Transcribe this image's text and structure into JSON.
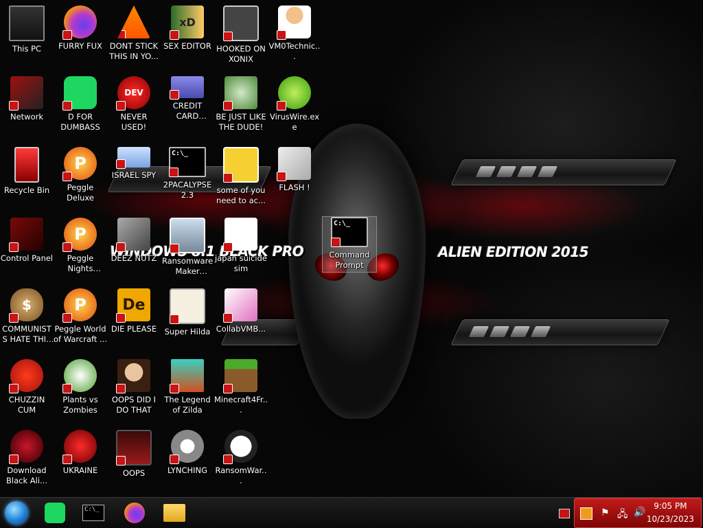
{
  "wallpaper": {
    "banner_left": "WINDOWS 8.1 BLACK PRO",
    "banner_right": "ALIEN EDITION 2015"
  },
  "desktop_icons": [
    {
      "label": "This PC",
      "icon": "computer-icon"
    },
    {
      "label": "FURRY FUX",
      "icon": "firefox-icon"
    },
    {
      "label": "DONT STICK THIS IN YO...",
      "icon": "vlc-cone-icon"
    },
    {
      "label": "SEX EDITOR",
      "icon": "hxd-icon"
    },
    {
      "label": "HOOKED ON XONIX",
      "icon": "xonix-icon"
    },
    {
      "label": "VM0Technic...",
      "icon": "person-icon"
    },
    {
      "label": "Network",
      "icon": "network-icon"
    },
    {
      "label": "D FOR DUMBASS",
      "icon": "spotify-icon"
    },
    {
      "label": "NEVER USED!",
      "icon": "devcpp-icon"
    },
    {
      "label": "CREDIT CARD CHECKER",
      "icon": "credit-card-icon"
    },
    {
      "label": "BE JUST LIKE THE DUDE!",
      "icon": "elf-icon"
    },
    {
      "label": "VirusWire.exe",
      "icon": "limewire-icon"
    },
    {
      "label": "Recycle Bin",
      "icon": "recycle-bin-icon"
    },
    {
      "label": "Peggle Deluxe",
      "icon": "peggle-icon"
    },
    {
      "label": "ISRAEL SPY",
      "icon": "spy-icon"
    },
    {
      "label": "2PACALYPSE 2.3",
      "icon": "terminal-icon"
    },
    {
      "label": "some of you need to ac...",
      "icon": "beaver-icon"
    },
    {
      "label": "FLASH !",
      "icon": "flash-icon"
    },
    {
      "label": "Control Panel",
      "icon": "control-panel-icon"
    },
    {
      "label": "Peggle Nights Deluxe",
      "icon": "peggle-icon"
    },
    {
      "label": "DEEZ NUTZ",
      "icon": "windows-stack-icon"
    },
    {
      "label": "Ransomware Maker Build...",
      "icon": "app-window-icon"
    },
    {
      "label": "japan suicide sim",
      "icon": "document-icon"
    },
    {
      "label": "Command Prompt",
      "icon": "terminal-icon"
    },
    {
      "label": "COMMUNISTS HATE THIS G...",
      "icon": "money-bag-icon"
    },
    {
      "label": "Peggle World of Warcraft ...",
      "icon": "peggle-icon"
    },
    {
      "label": "DIE PLEASE",
      "icon": "adobe-de-icon"
    },
    {
      "label": "Super Hilda",
      "icon": "dog-icon"
    },
    {
      "label": "CollabVMB...",
      "icon": "collabvm-icon"
    },
    {
      "label": "CHUZZIN CUM",
      "icon": "chuzzle-icon"
    },
    {
      "label": "Plants vs Zombies",
      "icon": "plant-icon"
    },
    {
      "label": "OOPS DID I DO THAT",
      "icon": "portrait-icon"
    },
    {
      "label": "The Legend of Zilda",
      "icon": "pixel-hero-icon"
    },
    {
      "label": "Minecraft4Fr...",
      "icon": "grass-block-icon"
    },
    {
      "label": "Download Black Ali...",
      "icon": "black-alien-icon"
    },
    {
      "label": "UKRAINE",
      "icon": "radiation-icon"
    },
    {
      "label": "OOPS",
      "icon": "oops-icon"
    },
    {
      "label": "LYNCHING",
      "icon": "gear-icon"
    },
    {
      "label": "RansomWar...",
      "icon": "skull-icon"
    }
  ],
  "taskbar": {
    "start": "start-orb-icon",
    "pinned": [
      "spotify-icon",
      "terminal-icon",
      "firefox-icon",
      "file-explorer-icon"
    ]
  },
  "tray": {
    "time": "9:05 PM",
    "date": "10/23/2023"
  },
  "colors": {
    "accent_red": "#c21b1b",
    "shortcut_badge": "#c81414"
  }
}
